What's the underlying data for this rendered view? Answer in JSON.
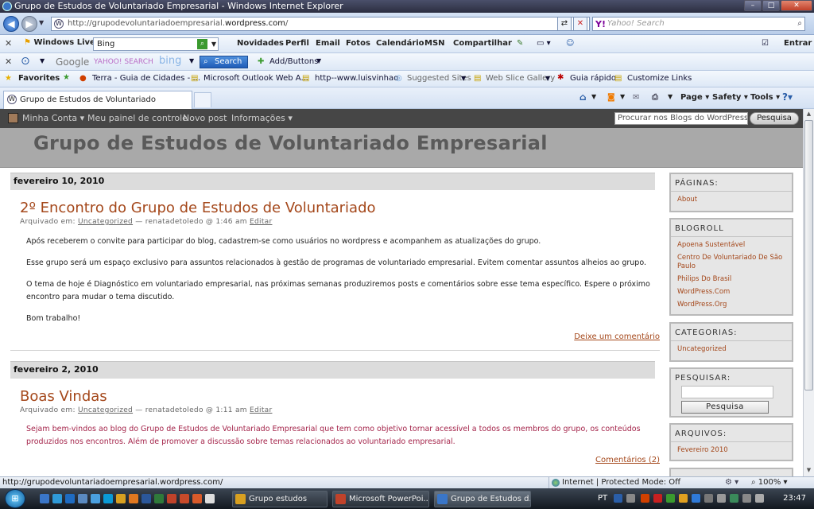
{
  "window": {
    "title": "Grupo de Estudos de Voluntariado Empresarial - Windows Internet Explorer",
    "minimize": "–",
    "maximize": "□",
    "close": "✕"
  },
  "address": {
    "url_prefix": "http://grupodevoluntariadoempresarial.",
    "url_domain": "wordpress.com",
    "url_suffix": "/",
    "search_placeholder": "Yahoo! Search",
    "search_brand": "Y!"
  },
  "windows_live_bar": {
    "brand": "Windows Live",
    "search_value": "Bing",
    "links": [
      "Novidades",
      "Perfil",
      "Email",
      "Fotos",
      "Calendário",
      "MSN",
      "Compartilhar"
    ],
    "signin": "Entrar"
  },
  "search_bar": {
    "engines": [
      "Google",
      "YAHOO! SEARCH",
      "bing"
    ],
    "search_button": "Search",
    "add_buttons": "Add/Buttons"
  },
  "favorites_bar": {
    "label": "Favorites",
    "items": [
      "Terra - Guia de Cidades - ...",
      "Microsoft Outlook Web A...",
      "http--www.luisvinhao",
      "Suggested Sites",
      "Web Slice Gallery",
      "Guia rápido",
      "Customize Links"
    ]
  },
  "tabs": {
    "active": "Grupo de Estudos de Voluntariado Empresarial",
    "commands": [
      "Page",
      "Safety",
      "Tools"
    ]
  },
  "wp_admin": {
    "items": [
      "Minha Conta",
      "Meu painel de controle",
      "Novo post",
      "Informações"
    ],
    "search_placeholder": "Procurar nos Blogs do WordPress.com",
    "search_button": "Pesquisa"
  },
  "blog": {
    "title": "Grupo de Estudos de Voluntariado Empresarial",
    "posts": [
      {
        "date": "fevereiro 10, 2010",
        "title": "2º Encontro do Grupo de Estudos de Voluntariado",
        "meta_prefix": "Arquivado em:",
        "category": "Uncategorized",
        "meta_author": "— renatadetoledo @ 1:46 am",
        "edit": "Editar",
        "paragraphs": [
          "Após receberem o convite para participar do blog, cadastrem-se como usuários no wordpress e acompanhem as atualizações do grupo.",
          "Esse grupo será um espaço exclusivo para assuntos relacionados à gestão de programas de voluntariado empresarial. Evitem comentar assuntos alheios ao grupo.",
          "O tema de hoje é Diagnóstico em voluntariado empresarial, nas próximas semanas produziremos posts e comentários sobre esse tema específico. Espere o próximo encontro para mudar o tema discutido.",
          "Bom trabalho!"
        ],
        "comments": "Deixe um comentário"
      },
      {
        "date": "fevereiro 2, 2010",
        "title": "Boas Vindas",
        "meta_prefix": "Arquivado em:",
        "category": "Uncategorized",
        "meta_author": "— renatadetoledo @ 1:11 am",
        "edit": "Editar",
        "paragraphs": [
          "Sejam bem-vindos ao blog do Grupo de Estudos de Voluntariado Empresarial que tem como objetivo tornar acessível a todos os membros do grupo, os conteúdos produzidos nos encontros. Além de promover a discussão sobre temas relacionados ao voluntariado empresarial."
        ],
        "comments": "Comentários (2)"
      }
    ]
  },
  "sidebar": {
    "paginas": {
      "title": "PÁGINAS:",
      "links": [
        "About"
      ]
    },
    "blogroll": {
      "title": "BLOGROLL",
      "links": [
        "Apoena Sustentável",
        "Centro De Voluntariado De São Paulo",
        "Philips Do Brasil",
        "WordPress.Com",
        "WordPress.Org"
      ]
    },
    "categorias": {
      "title": "CATEGORIAS:",
      "links": [
        "Uncategorized"
      ]
    },
    "pesquisar": {
      "title": "PESQUISAR:",
      "button": "Pesquisa"
    },
    "arquivos": {
      "title": "ARQUIVOS:",
      "links": [
        "Fevereiro 2010"
      ]
    }
  },
  "status": {
    "url": "http://grupodevoluntariadoempresarial.wordpress.com/",
    "zone": "Internet | Protected Mode: Off",
    "zoom": "100%"
  },
  "taskbar": {
    "tasks": [
      "Grupo estudos",
      "Microsoft PowerPoi...",
      "Grupo de Estudos d..."
    ],
    "lang": "PT",
    "clock": "23:47"
  },
  "colors": {
    "post_title": "#a4471a",
    "post_text_red": "#a4244a",
    "blog_header": "#a9a9a9",
    "wp_admin_bar": "#464646"
  }
}
